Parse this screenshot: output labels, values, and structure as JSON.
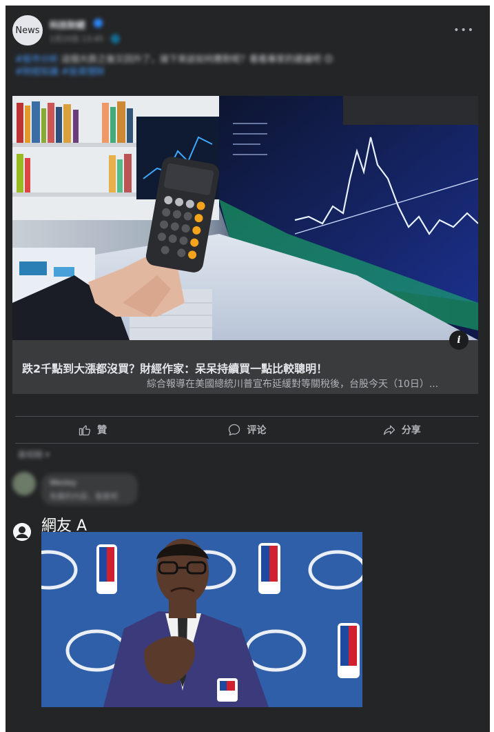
{
  "post": {
    "source_avatar_label": "News",
    "page_name": "科技財經",
    "meta": "1月10日 13:45 · 🌐",
    "text_link": "#股市分析",
    "text_body": " 這個大跌之後又回升了，接下來該如何應對呢？看看專家的建議吧",
    "text_link2": "#財經知識 #投資理財"
  },
  "link_card": {
    "title": "跌2千點到大漲都沒買？財經作家：呆呆持續買一點比較聰明！",
    "description": "綜合報導在美國總統川普宣布延緩對等關稅後，台股今天（10日）..."
  },
  "actions": {
    "like": "贊",
    "comment": "评论",
    "share": "分享"
  },
  "comments": {
    "sort_label": "最相關 ▾",
    "first_name": "Wesley",
    "first_text": "有趣的內容，看看吧",
    "second_name": "網友 A"
  },
  "colors": {
    "panel_bg": "#242526",
    "card_bg": "#3a3b3c",
    "link_blue": "#4599ff",
    "text_primary": "#e4e6eb",
    "text_secondary": "#b0b3b8"
  }
}
